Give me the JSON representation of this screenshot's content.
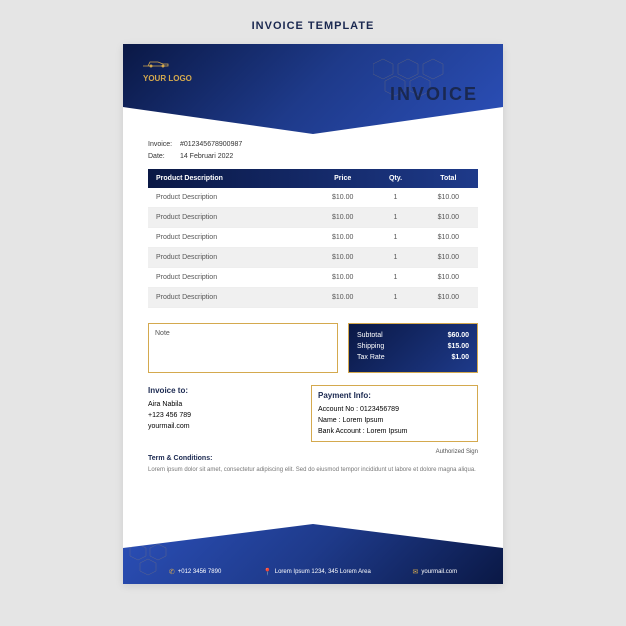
{
  "page_title": "INVOICE TEMPLATE",
  "logo": {
    "text": "YOUR LOGO"
  },
  "invoice_title": "INVOICE",
  "meta": {
    "invoice_label": "Invoice:",
    "invoice_number": "#012345678900987",
    "date_label": "Date:",
    "date_value": "14 Februari 2022"
  },
  "table": {
    "headers": {
      "desc": "Product Description",
      "price": "Price",
      "qty": "Qty.",
      "total": "Total"
    },
    "rows": [
      {
        "desc": "Product Description",
        "price": "$10.00",
        "qty": "1",
        "total": "$10.00"
      },
      {
        "desc": "Product Description",
        "price": "$10.00",
        "qty": "1",
        "total": "$10.00"
      },
      {
        "desc": "Product Description",
        "price": "$10.00",
        "qty": "1",
        "total": "$10.00"
      },
      {
        "desc": "Product Description",
        "price": "$10.00",
        "qty": "1",
        "total": "$10.00"
      },
      {
        "desc": "Product Description",
        "price": "$10.00",
        "qty": "1",
        "total": "$10.00"
      },
      {
        "desc": "Product Description",
        "price": "$10.00",
        "qty": "1",
        "total": "$10.00"
      }
    ]
  },
  "note": {
    "label": "Note"
  },
  "summary": {
    "subtotal_label": "Subtotal",
    "subtotal": "$60.00",
    "shipping_label": "Shipping",
    "shipping": "$15.00",
    "tax_label": "Tax Rate",
    "tax": "$1.00"
  },
  "invoice_to": {
    "heading": "Invoice to:",
    "name": "Aira Nabila",
    "phone": "+123 456 789",
    "email": "yourmail.com"
  },
  "payment": {
    "heading": "Payment Info:",
    "account_label": "Account No",
    "account": "0123456789",
    "name_label": "Name",
    "name": "Lorem Ipsum",
    "bank_label": "Bank Account",
    "bank": "Lorem Ipsum"
  },
  "terms": {
    "heading": "Term & Conditions:",
    "body": "Lorem ipsum dolor sit amet, consectetur adipiscing elit. Sed do eiusmod tempor incididunt ut labore et dolore magna aliqua."
  },
  "auth_sign": "Authorized Sign",
  "footer": {
    "phone": "+012 3456 7890",
    "address": "Lorem Ipsum 1234, 345 Lorem Area",
    "email": "yourmail.com"
  }
}
